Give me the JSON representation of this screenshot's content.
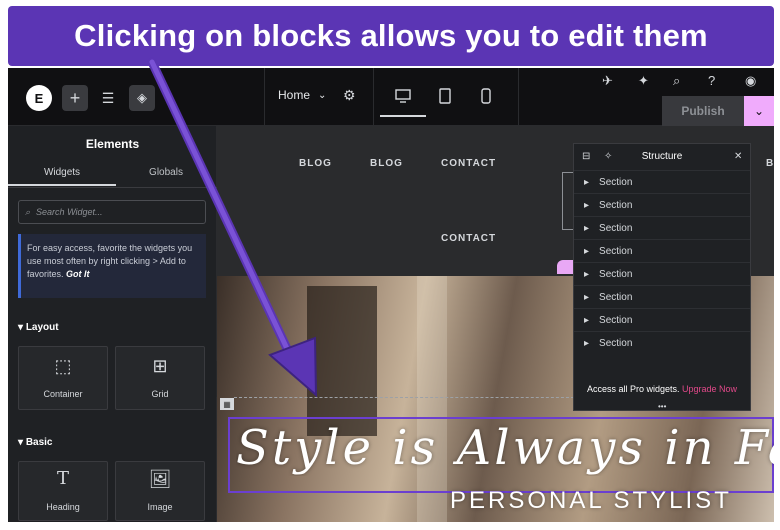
{
  "banner": {
    "text": "Clicking on blocks allows you to edit them"
  },
  "topbar": {
    "logo": "E",
    "page_selector": "Home",
    "publish_label": "Publish",
    "devices": [
      "desktop",
      "tablet",
      "mobile"
    ]
  },
  "panel": {
    "title": "Elements",
    "tabs": {
      "widgets": "Widgets",
      "globals": "Globals"
    },
    "search_placeholder": "Search Widget...",
    "tip": {
      "text": "For easy access, favorite the widgets you use most often by right clicking > Add to favorites.",
      "cta": "Got It"
    },
    "categories": {
      "layout": {
        "label": "Layout",
        "widgets": [
          {
            "label": "Container",
            "icon": "container-icon"
          },
          {
            "label": "Grid",
            "icon": "grid-icon"
          }
        ]
      },
      "basic": {
        "label": "Basic",
        "widgets": [
          {
            "label": "Heading",
            "icon": "heading-icon"
          },
          {
            "label": "Image",
            "icon": "image-icon"
          }
        ]
      }
    }
  },
  "canvas": {
    "nav_row1": [
      "BLOG",
      "BLOG",
      "CONTACT"
    ],
    "nav_row2": [
      "CONTACT"
    ],
    "headline": "Style is Always in Fashion",
    "subheadline": "PERSONAL STYLIST"
  },
  "structure": {
    "title": "Structure",
    "sections": [
      "Section",
      "Section",
      "Section",
      "Section",
      "Section",
      "Section",
      "Section",
      "Section"
    ],
    "footer_text": "Access all Pro widgets.",
    "footer_link": "Upgrade Now"
  },
  "colors": {
    "banner": "#5b35b4",
    "accent_pink": "#f0abfc",
    "selection": "#6b3fd0",
    "upgrade_link": "#e2498a"
  }
}
